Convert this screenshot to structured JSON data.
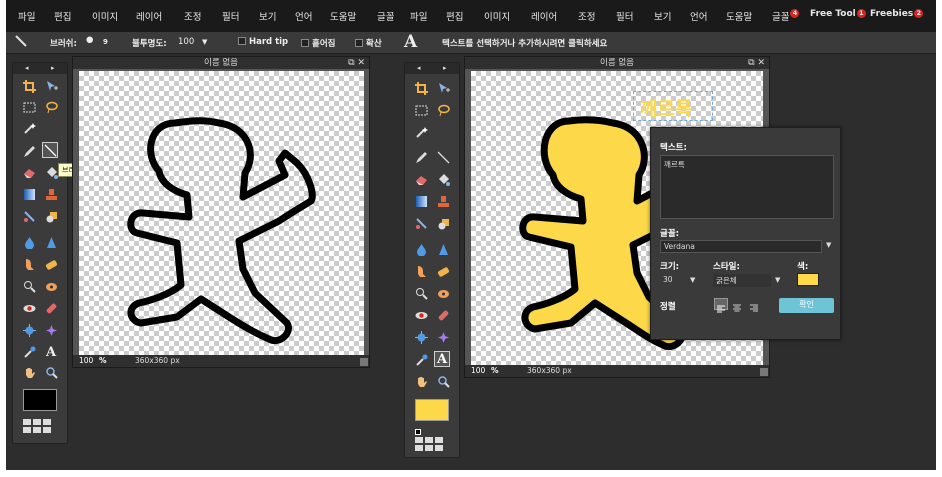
{
  "menubar_left": [
    "파일",
    "편집",
    "이미지",
    "레이어",
    "조정",
    "필터",
    "보기",
    "언어",
    "도움말",
    "글꼴"
  ],
  "menubar_right": {
    "items": [
      "파일",
      "편집",
      "이미지",
      "레이어",
      "조정",
      "필터",
      "보기",
      "언어",
      "도움말"
    ],
    "fonts": {
      "label": "글꼴",
      "badge": "4"
    },
    "free_tool": {
      "label": "Free Tool",
      "badge": "1"
    },
    "freebies": {
      "label": "Freebies",
      "badge": "2"
    }
  },
  "optionsbar": {
    "brush_label": "브러쉬:",
    "brush_size": "9",
    "opacity_label": "불투명도:",
    "opacity_value": "100",
    "hard_tip": "Hard tip",
    "smudge": "흩어짐",
    "diffuse": "확산",
    "text_tool_glyph": "A",
    "text_hint": "텍스트를 선택하거나 추가하시려면 클릭하세요"
  },
  "window_left": {
    "title": "이름 없음",
    "zoom": "100",
    "pct": "%",
    "size": "360x360 px"
  },
  "window_right": {
    "title": "이름 없음",
    "zoom": "100",
    "pct": "%",
    "size": "360x360 px"
  },
  "tooltip": "브러쉬 도구 (B)",
  "text_overlay": "깨르륵",
  "text_panel": {
    "text_label": "텍스트:",
    "text_value": "깨르륵",
    "font_label": "글꼴:",
    "font_value": "Verdana",
    "size_label": "크기:",
    "size_value": "30",
    "style_label": "스타일:",
    "style_value": "굵은체",
    "color_label": "색:",
    "align_label": "정렬",
    "ok_label": "확인"
  },
  "colors": {
    "fill_yellow": "#fdd94a",
    "fg_left": "#000000",
    "fg_right": "#fdd94a"
  }
}
